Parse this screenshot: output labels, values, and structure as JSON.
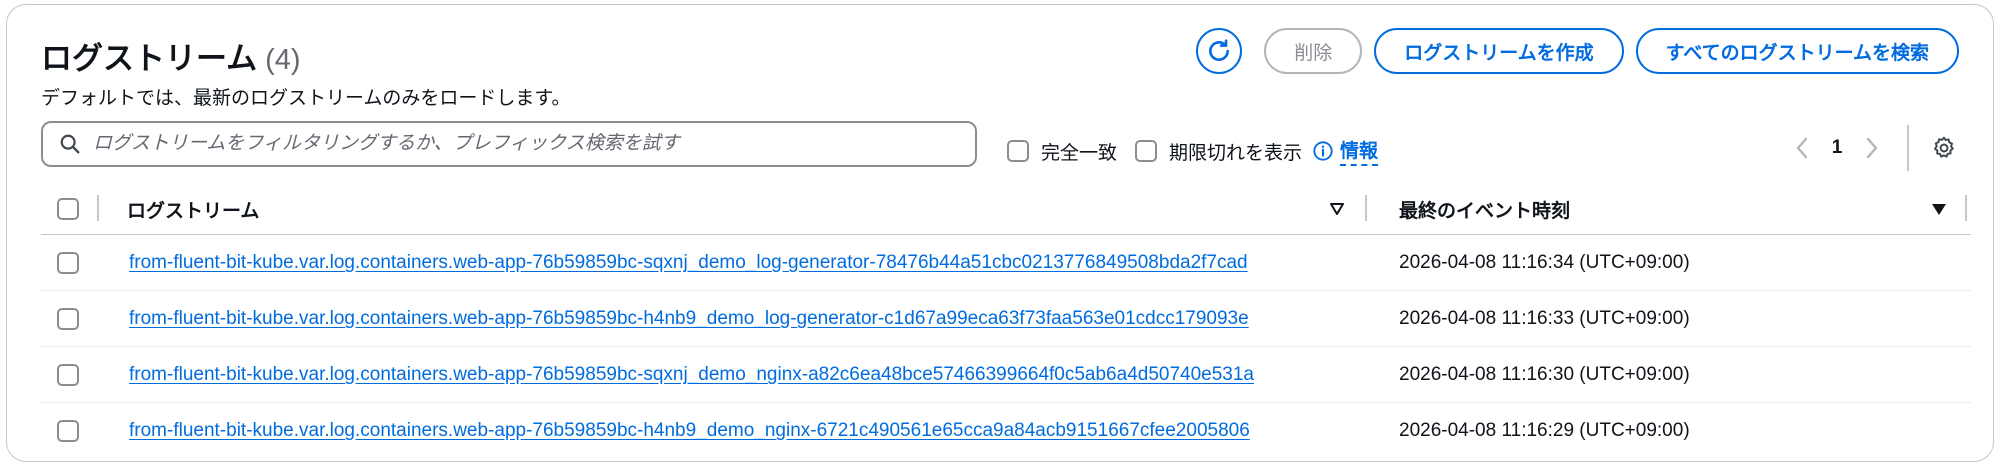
{
  "header": {
    "title": "ログストリーム",
    "count": "(4)",
    "description": "デフォルトでは、最新のログストリームのみをロードします。"
  },
  "actions": {
    "refresh_icon": "refresh-icon",
    "delete_label": "削除",
    "create_label": "ログストリームを作成",
    "search_all_label": "すべてのログストリームを検索"
  },
  "filter": {
    "placeholder": "ログストリームをフィルタリングするか、プレフィックス検索を試す",
    "exact_match_label": "完全一致",
    "show_expired_label": "期限切れを表示",
    "info_label": "情報"
  },
  "pagination": {
    "current_page": "1"
  },
  "table": {
    "columns": [
      "ログストリーム",
      "最終のイベント時刻"
    ],
    "rows": [
      {
        "stream": "from-fluent-bit-kube.var.log.containers.web-app-76b59859bc-sqxnj_demo_log-generator-78476b44a51cbc0213776849508bda2f7cad",
        "time": "2026-04-08 11:16:34 (UTC+09:00)"
      },
      {
        "stream": "from-fluent-bit-kube.var.log.containers.web-app-76b59859bc-h4nb9_demo_log-generator-c1d67a99eca63f73faa563e01cdcc179093e",
        "time": "2026-04-08 11:16:33 (UTC+09:00)"
      },
      {
        "stream": "from-fluent-bit-kube.var.log.containers.web-app-76b59859bc-sqxnj_demo_nginx-a82c6ea48bce57466399664f0c5ab6a4d50740e531a",
        "time": "2026-04-08 11:16:30 (UTC+09:00)"
      },
      {
        "stream": "from-fluent-bit-kube.var.log.containers.web-app-76b59859bc-h4nb9_demo_nginx-6721c490561e65cca9a84acb9151667cfee2005806",
        "time": "2026-04-08 11:16:29 (UTC+09:00)"
      }
    ]
  },
  "colors": {
    "accent": "#006ce0",
    "text": "#0f141a",
    "muted": "#656871",
    "border": "#c6c6cd"
  }
}
